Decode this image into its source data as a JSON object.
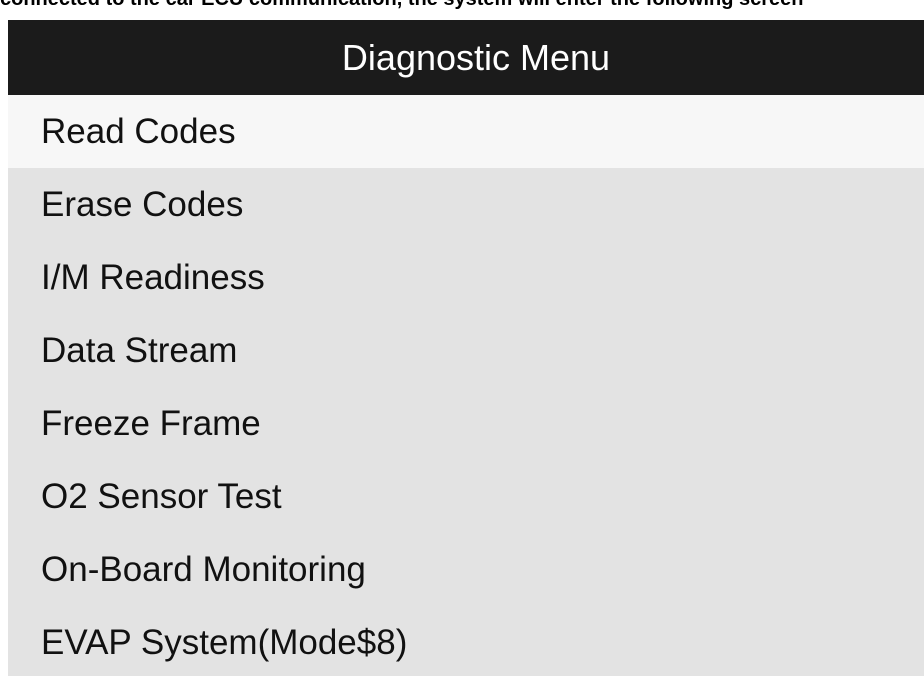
{
  "caption": "connected to the car ECU communication, the system will enter the following screen",
  "header": {
    "title": "Diagnostic Menu"
  },
  "menu": {
    "selected_index": 0,
    "items": [
      {
        "label": "Read Codes"
      },
      {
        "label": "Erase Codes"
      },
      {
        "label": "I/M Readiness"
      },
      {
        "label": "Data Stream"
      },
      {
        "label": "Freeze Frame"
      },
      {
        "label": "O2 Sensor Test"
      },
      {
        "label": "On-Board Monitoring"
      },
      {
        "label": "EVAP System(Mode$8)"
      }
    ]
  },
  "colors": {
    "title_bar": "#1b1b1b",
    "list_background": "#e3e3e3",
    "selected_row": "#f7f7f7"
  }
}
